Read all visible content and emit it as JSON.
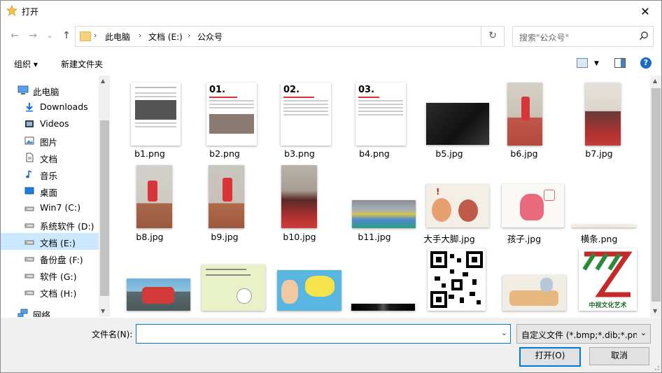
{
  "window": {
    "title": "打开",
    "close_label": "✕"
  },
  "nav": {
    "back": "←",
    "forward": "→",
    "recent": "⌄",
    "up": "↑",
    "breadcrumbs": [
      "此电脑",
      "文档 (E:)",
      "公众号"
    ],
    "search_placeholder": "搜索\"公众号\""
  },
  "toolbar": {
    "organize": "组织 ▾",
    "new_folder": "新建文件夹"
  },
  "sidebar": {
    "items": [
      {
        "label": "此电脑",
        "icon": "computer-icon"
      },
      {
        "label": "Downloads",
        "icon": "download-icon"
      },
      {
        "label": "Videos",
        "icon": "video-icon"
      },
      {
        "label": "图片",
        "icon": "pictures-icon"
      },
      {
        "label": "文档",
        "icon": "documents-icon"
      },
      {
        "label": "音乐",
        "icon": "music-icon"
      },
      {
        "label": "桌面",
        "icon": "desktop-icon"
      },
      {
        "label": "Win7 (C:)",
        "icon": "drive-icon"
      },
      {
        "label": "系统软件 (D:)",
        "icon": "drive-icon"
      },
      {
        "label": "文档 (E:)",
        "icon": "drive-icon",
        "selected": true
      },
      {
        "label": "备份盘 (F:)",
        "icon": "drive-icon"
      },
      {
        "label": "软件 (G:)",
        "icon": "drive-icon"
      },
      {
        "label": "文档 (H:)",
        "icon": "drive-icon"
      },
      {
        "label": "网络",
        "icon": "network-icon"
      }
    ]
  },
  "files": [
    {
      "name": "b1.png"
    },
    {
      "name": "b2.png"
    },
    {
      "name": "b3.png"
    },
    {
      "name": "b4.png"
    },
    {
      "name": "b5.jpg"
    },
    {
      "name": "b6.jpg"
    },
    {
      "name": "b7.jpg"
    },
    {
      "name": "b8.jpg"
    },
    {
      "name": "b9.jpg"
    },
    {
      "name": "b10.jpg"
    },
    {
      "name": "b11.jpg"
    },
    {
      "name": "大手大脚.jpg"
    },
    {
      "name": "孩子.jpg"
    },
    {
      "name": "横条.png"
    },
    {
      "name": ""
    },
    {
      "name": ""
    },
    {
      "name": ""
    },
    {
      "name": ""
    },
    {
      "name": ""
    },
    {
      "name": ""
    },
    {
      "name": ""
    }
  ],
  "thumb_text": {
    "b2_heading": "01.",
    "b3_heading": "02.",
    "b4_heading": "03.",
    "b19_caption": "中视文化艺术"
  },
  "bottom": {
    "filename_label": "文件名(N):",
    "filename_value": "",
    "filetype": "自定义文件 (*.bmp;*.dib;*.png",
    "open_label": "打开(O)",
    "cancel_label": "取消"
  },
  "colors": {
    "accent": "#0078d7",
    "selected_bg": "#cce8ff",
    "folder": "#f6d27a"
  }
}
